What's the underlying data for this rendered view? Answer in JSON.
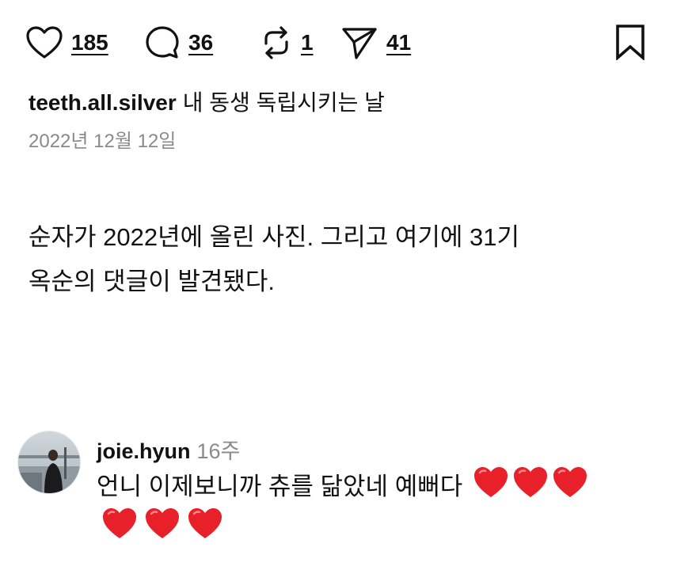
{
  "actions": {
    "likes": "185",
    "comments": "36",
    "reposts": "1",
    "shares": "41"
  },
  "post": {
    "username": "teeth.all.silver",
    "caption": "내 동생 독립시키는 날",
    "date": "2022년 12월 12일"
  },
  "body": {
    "line1": "순자가 2022년에 올린 사진. 그리고 여기에 31기",
    "line2": "옥순의 댓글이 발견됐다."
  },
  "comment": {
    "username": "joie.hyun",
    "time": "16주",
    "text": "언니 이제보니까 츄를 닮았네 예뻐다",
    "emoji": "heart",
    "emoji_count": 6
  },
  "colors": {
    "text": "#111111",
    "muted": "#8a8a8a",
    "heart_red": "#e8202a"
  }
}
